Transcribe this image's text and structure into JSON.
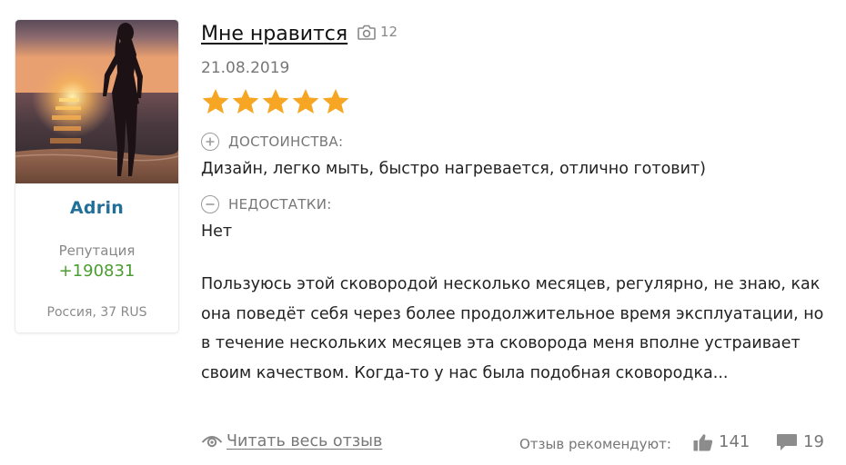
{
  "user": {
    "name": "Adrin",
    "reputation_label": "Репутация",
    "reputation_value": "+190831",
    "location": "Россия, 37 RUS"
  },
  "review": {
    "title": "Мне нравится",
    "photo_count": "12",
    "date": "21.08.2019",
    "rating": 5,
    "pros_label": "ДОСТОИНСТВА:",
    "pros_text": "Дизайн, легко мыть, быстро нагревается, отлично готовит)",
    "cons_label": "НЕДОСТАТКИ:",
    "cons_text": "Нет",
    "body": "Пользуюсь этой сковородой несколько месяцев, регулярно, не знаю, как она поведёт себя через более продолжительное время эксплуатации, но в течение нескольких месяцев эта сковорода меня вполне устраивает своим качеством. Когда-то у нас была подобная сковородка..."
  },
  "footer": {
    "read_full_label": "Читать весь отзыв",
    "recommend_label": "Отзыв рекомендуют:",
    "likes": "141",
    "comments": "19"
  },
  "colors": {
    "star": "#f6a623",
    "username": "#22709a",
    "reputation": "#4a9e31"
  },
  "icons": [
    "camera-icon",
    "star-icon",
    "plus-circle-icon",
    "minus-circle-icon",
    "eye-icon",
    "thumbs-up-icon",
    "comment-icon"
  ]
}
